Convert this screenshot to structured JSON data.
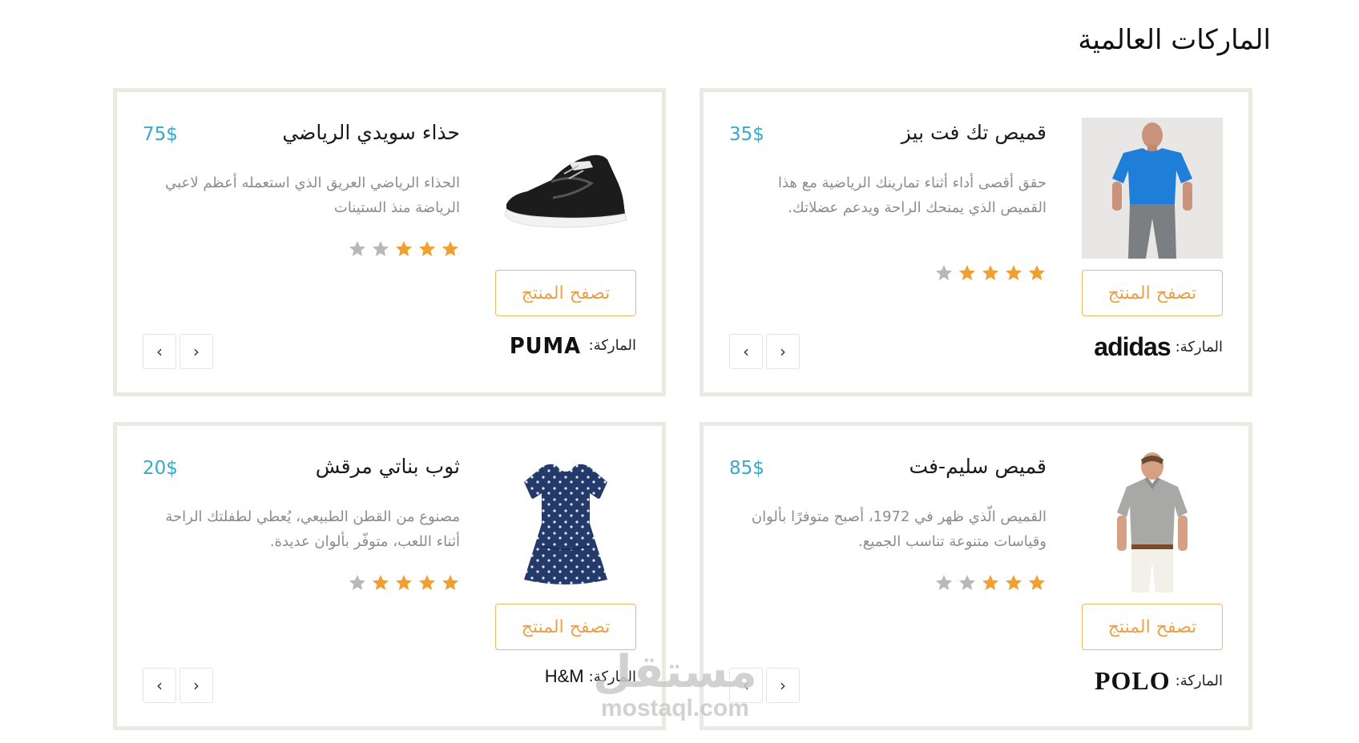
{
  "section": {
    "title": "الماركات العالمية"
  },
  "colors": {
    "price": "#39a9c9",
    "accent_orange": "#e9a24a",
    "star_on": "#f0a030",
    "star_off": "#b8b8b8",
    "card_border": "#ece9e2"
  },
  "products": [
    {
      "name": "قميص تك فت بيز",
      "price": "35$",
      "description": "حقق أقصى أداء أثناء تمارينك الرياضية مع هذا القميص الذي يمنحك الراحة ويدعم عضلاتك.",
      "rating": 4,
      "rating_max": 5,
      "image_icon": "blue-tshirt-model-photo",
      "browse_label": "تصفح المنتج",
      "brand_label": "الماركة:",
      "brand_logo": "adidas",
      "brand_logo_icon": "adidas-logo",
      "nav_prev": "‹",
      "nav_next": "›"
    },
    {
      "name": "حذاء سويدي الرياضي",
      "price": "75$",
      "description": "الحذاء الرياضي العريق الذي استعمله أعظم لاعبي الرياضة منذ الستينات",
      "rating": 3,
      "rating_max": 5,
      "image_icon": "black-sneaker-photo",
      "browse_label": "تصفح المنتج",
      "brand_label": "الماركة:",
      "brand_logo": "PUMA",
      "brand_logo_icon": "puma-logo",
      "nav_prev": "‹",
      "nav_next": "›"
    },
    {
      "name": "قميص سليم-فت",
      "price": "85$",
      "description": "القميص الّذي ظهر في 1972، أصبح متوفرًا بألوان وقياسات متنوعة تناسب الجميع.",
      "rating": 3,
      "rating_max": 5,
      "image_icon": "grey-polo-shirt-model-photo",
      "browse_label": "تصفح المنتج",
      "brand_label": "الماركة:",
      "brand_logo": "POLO",
      "brand_logo_icon": "polo-logo",
      "nav_prev": "‹",
      "nav_next": "›"
    },
    {
      "name": "ثوب بناتي مرقش",
      "price": "20$",
      "description": "مصنوع من القطن الطبيعي، يُعطي لطفلتك الراحة أثناء اللعب، متوفّر بألوان عديدة.",
      "rating": 4,
      "rating_max": 5,
      "image_icon": "navy-polka-dot-dress-photo",
      "browse_label": "تصفح المنتج",
      "brand_label": "الماركة:",
      "brand_logo": "H&M",
      "brand_logo_icon": "hm-logo",
      "nav_prev": "‹",
      "nav_next": "›"
    }
  ],
  "watermark": {
    "arabic": "مستقل",
    "latin": "mostaql.com"
  }
}
